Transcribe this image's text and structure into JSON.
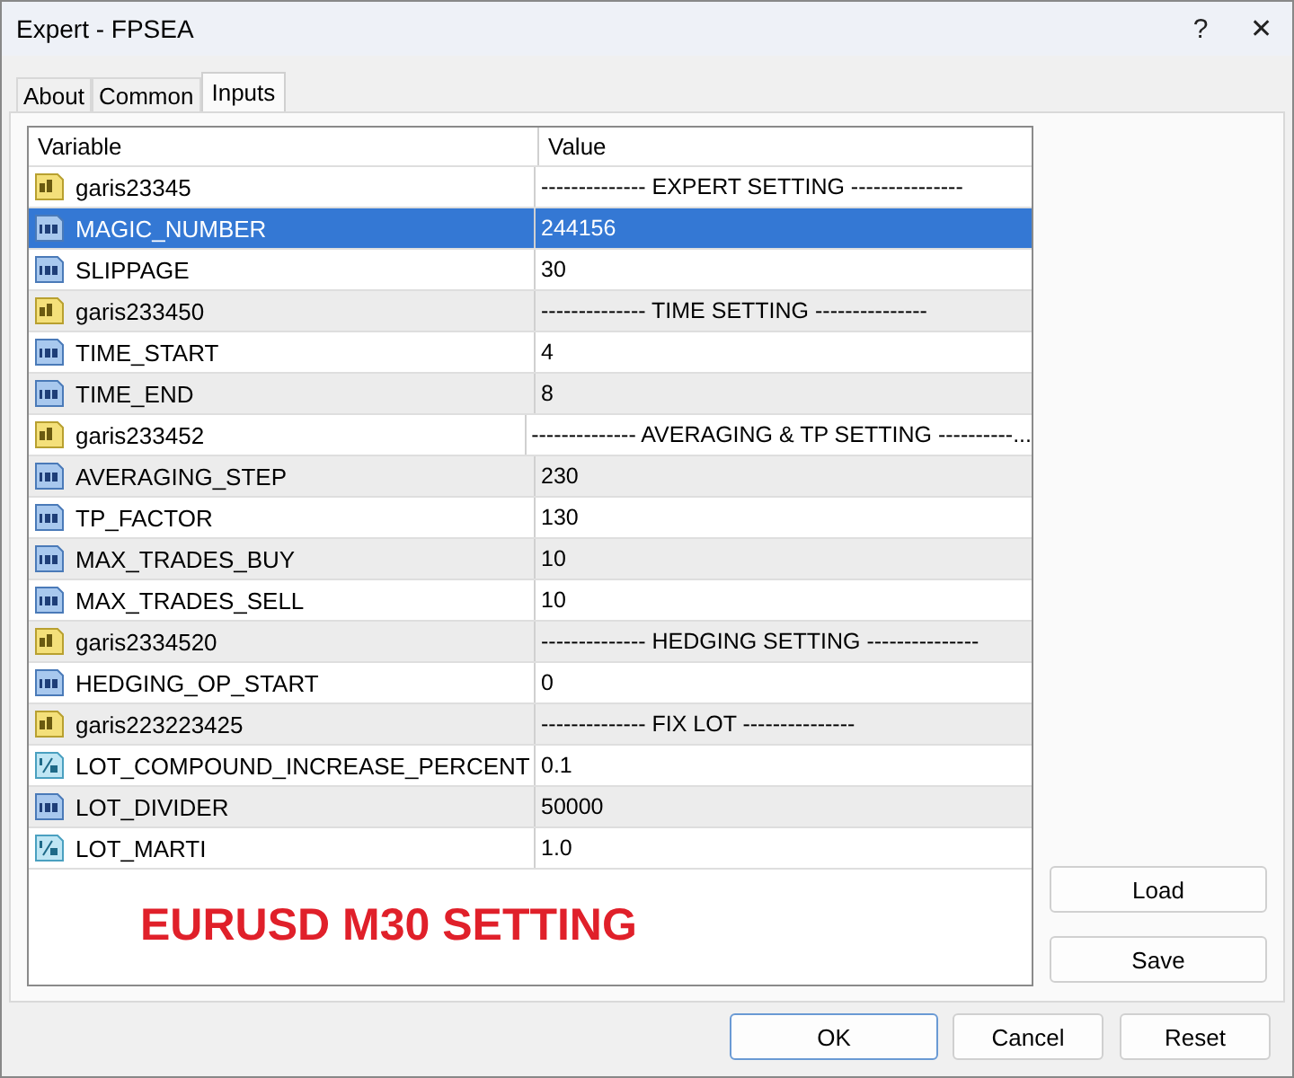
{
  "window": {
    "title": "Expert - FPSEA",
    "help": "?",
    "close": "✕"
  },
  "tabs": [
    {
      "label": "About",
      "selected": false
    },
    {
      "label": "Common",
      "selected": false
    },
    {
      "label": "Inputs",
      "selected": true
    }
  ],
  "table": {
    "columns": [
      "Variable",
      "Value"
    ],
    "rows": [
      {
        "kind": "string",
        "variable": "garis23345",
        "value": "-------------- EXPERT SETTING ---------------",
        "selected": false
      },
      {
        "kind": "int",
        "variable": "MAGIC_NUMBER",
        "value": "244156",
        "selected": true
      },
      {
        "kind": "int",
        "variable": "SLIPPAGE",
        "value": "30",
        "selected": false
      },
      {
        "kind": "string",
        "variable": "garis233450",
        "value": "-------------- TIME SETTING ---------------",
        "selected": false
      },
      {
        "kind": "int",
        "variable": "TIME_START",
        "value": "4",
        "selected": false
      },
      {
        "kind": "int",
        "variable": "TIME_END",
        "value": "8",
        "selected": false
      },
      {
        "kind": "string",
        "variable": "garis233452",
        "value": "-------------- AVERAGING & TP SETTING ----------...",
        "selected": false
      },
      {
        "kind": "int",
        "variable": "AVERAGING_STEP",
        "value": "230",
        "selected": false
      },
      {
        "kind": "int",
        "variable": "TP_FACTOR",
        "value": "130",
        "selected": false
      },
      {
        "kind": "int",
        "variable": "MAX_TRADES_BUY",
        "value": "10",
        "selected": false
      },
      {
        "kind": "int",
        "variable": "MAX_TRADES_SELL",
        "value": "10",
        "selected": false
      },
      {
        "kind": "string",
        "variable": "garis2334520",
        "value": "-------------- HEDGING SETTING ---------------",
        "selected": false
      },
      {
        "kind": "int",
        "variable": "HEDGING_OP_START",
        "value": "0",
        "selected": false
      },
      {
        "kind": "string",
        "variable": "garis223223425",
        "value": "-------------- FIX LOT ---------------",
        "selected": false
      },
      {
        "kind": "double",
        "variable": "LOT_COMPOUND_INCREASE_PERCENT",
        "value": "0.1",
        "selected": false
      },
      {
        "kind": "int",
        "variable": "LOT_DIVIDER",
        "value": "50000",
        "selected": false
      },
      {
        "kind": "double",
        "variable": "LOT_MARTI",
        "value": "1.0",
        "selected": false
      }
    ]
  },
  "overlay_note": "EURUSD M30 SETTING",
  "side_buttons": [
    "Load",
    "Save"
  ],
  "buttons": [
    {
      "label": "OK",
      "default": true
    },
    {
      "label": "Cancel",
      "default": false
    },
    {
      "label": "Reset",
      "default": false
    }
  ]
}
